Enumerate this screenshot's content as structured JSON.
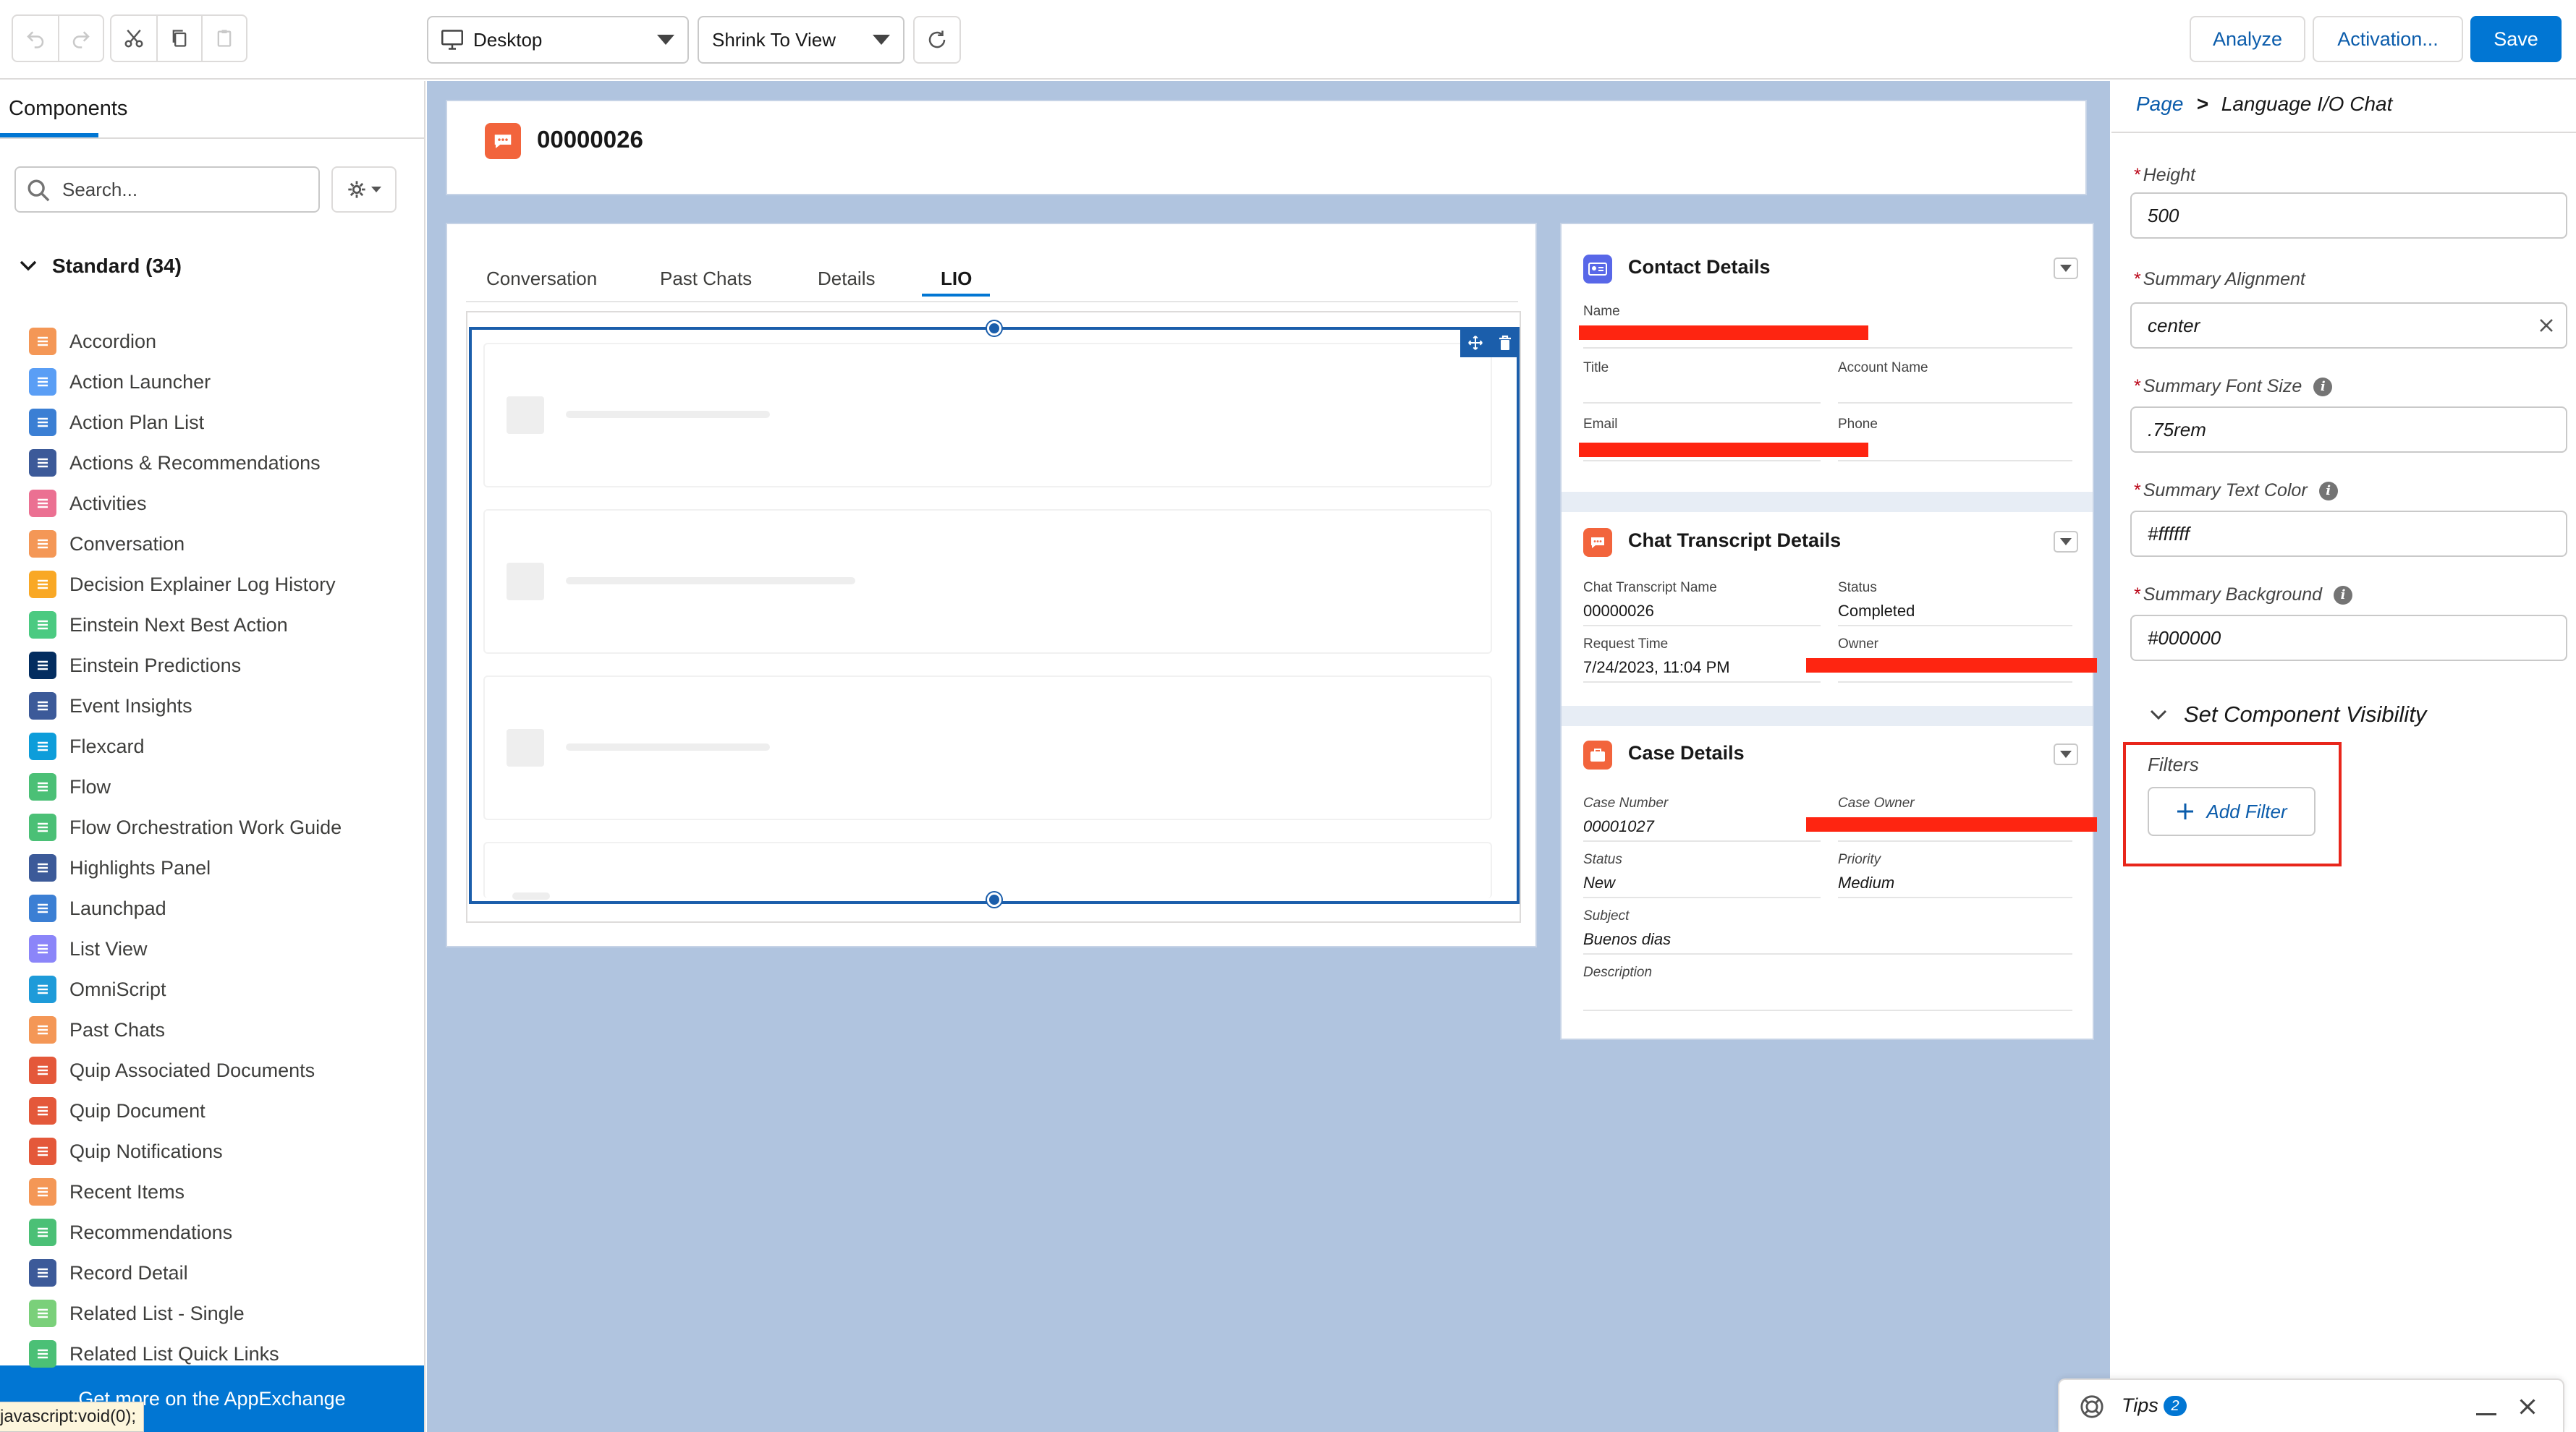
{
  "toolbar": {
    "device_select": "Desktop",
    "view_select": "Shrink To View",
    "analyze_label": "Analyze",
    "activation_label": "Activation...",
    "save_label": "Save"
  },
  "left_panel": {
    "tab_label": "Components",
    "search_placeholder": "Search...",
    "section_label": "Standard (34)",
    "items": [
      {
        "label": "Accordion",
        "color": "#f49756"
      },
      {
        "label": "Action Launcher",
        "color": "#5a9ef5"
      },
      {
        "label": "Action Plan List",
        "color": "#3b7fd4"
      },
      {
        "label": "Actions & Recommendations",
        "color": "#3c5a99"
      },
      {
        "label": "Activities",
        "color": "#eb7092"
      },
      {
        "label": "Conversation",
        "color": "#f49756"
      },
      {
        "label": "Decision Explainer Log History",
        "color": "#f9a825"
      },
      {
        "label": "Einstein Next Best Action",
        "color": "#4bca81"
      },
      {
        "label": "Einstein Predictions",
        "color": "#032d60"
      },
      {
        "label": "Event Insights",
        "color": "#3c5a99"
      },
      {
        "label": "Flexcard",
        "color": "#0d9dda"
      },
      {
        "label": "Flow",
        "color": "#4bc076"
      },
      {
        "label": "Flow Orchestration Work Guide",
        "color": "#4bc076"
      },
      {
        "label": "Highlights Panel",
        "color": "#3c5a99"
      },
      {
        "label": "Launchpad",
        "color": "#3b7fd4"
      },
      {
        "label": "List View",
        "color": "#8b85f9"
      },
      {
        "label": "OmniScript",
        "color": "#1e9bd9"
      },
      {
        "label": "Past Chats",
        "color": "#f49756"
      },
      {
        "label": "Quip Associated Documents",
        "color": "#e4583a"
      },
      {
        "label": "Quip Document",
        "color": "#e4583a"
      },
      {
        "label": "Quip Notifications",
        "color": "#e4583a"
      },
      {
        "label": "Recent Items",
        "color": "#f49756"
      },
      {
        "label": "Recommendations",
        "color": "#4bc076"
      },
      {
        "label": "Record Detail",
        "color": "#3c5a99"
      },
      {
        "label": "Related List - Single",
        "color": "#7ad07a"
      },
      {
        "label": "Related List Quick Links",
        "color": "#4bc076"
      }
    ],
    "appexchange_label": "Get more on the AppExchange",
    "status_bar": "javascript:void(0);"
  },
  "canvas": {
    "record_title": "00000026",
    "tabs": [
      "Conversation",
      "Past Chats",
      "Details",
      "LIO"
    ],
    "contact_card": {
      "title": "Contact Details",
      "name_label": "Name",
      "title_label": "Title",
      "account_label": "Account Name",
      "email_label": "Email",
      "phone_label": "Phone"
    },
    "transcript_card": {
      "title": "Chat Transcript Details",
      "name_label": "Chat Transcript Name",
      "name_value": "00000026",
      "status_label": "Status",
      "status_value": "Completed",
      "request_label": "Request Time",
      "request_value": "7/24/2023, 11:04 PM",
      "owner_label": "Owner"
    },
    "case_card": {
      "title": "Case Details",
      "number_label": "Case Number",
      "number_value": "00001027",
      "owner_label": "Case Owner",
      "status_label": "Status",
      "status_value": "New",
      "priority_label": "Priority",
      "priority_value": "Medium",
      "subject_label": "Subject",
      "subject_value": "Buenos dias",
      "description_label": "Description"
    }
  },
  "right_panel": {
    "breadcrumb_root": "Page",
    "breadcrumb_sep": ">",
    "breadcrumb_current": "Language I/O Chat",
    "height_label": "Height",
    "height_value": "500",
    "align_label": "Summary Alignment",
    "align_value": "center",
    "font_label": "Summary Font Size",
    "font_value": ".75rem",
    "text_color_label": "Summary Text Color",
    "text_color_value": "#ffffff",
    "bg_label": "Summary Background",
    "bg_value": "#000000",
    "visibility_label": "Set Component Visibility",
    "filters_label": "Filters",
    "add_filter_label": "Add Filter",
    "required_mark": "*",
    "info_glyph": "i"
  },
  "tips": {
    "label": "Tips",
    "count": "2"
  }
}
